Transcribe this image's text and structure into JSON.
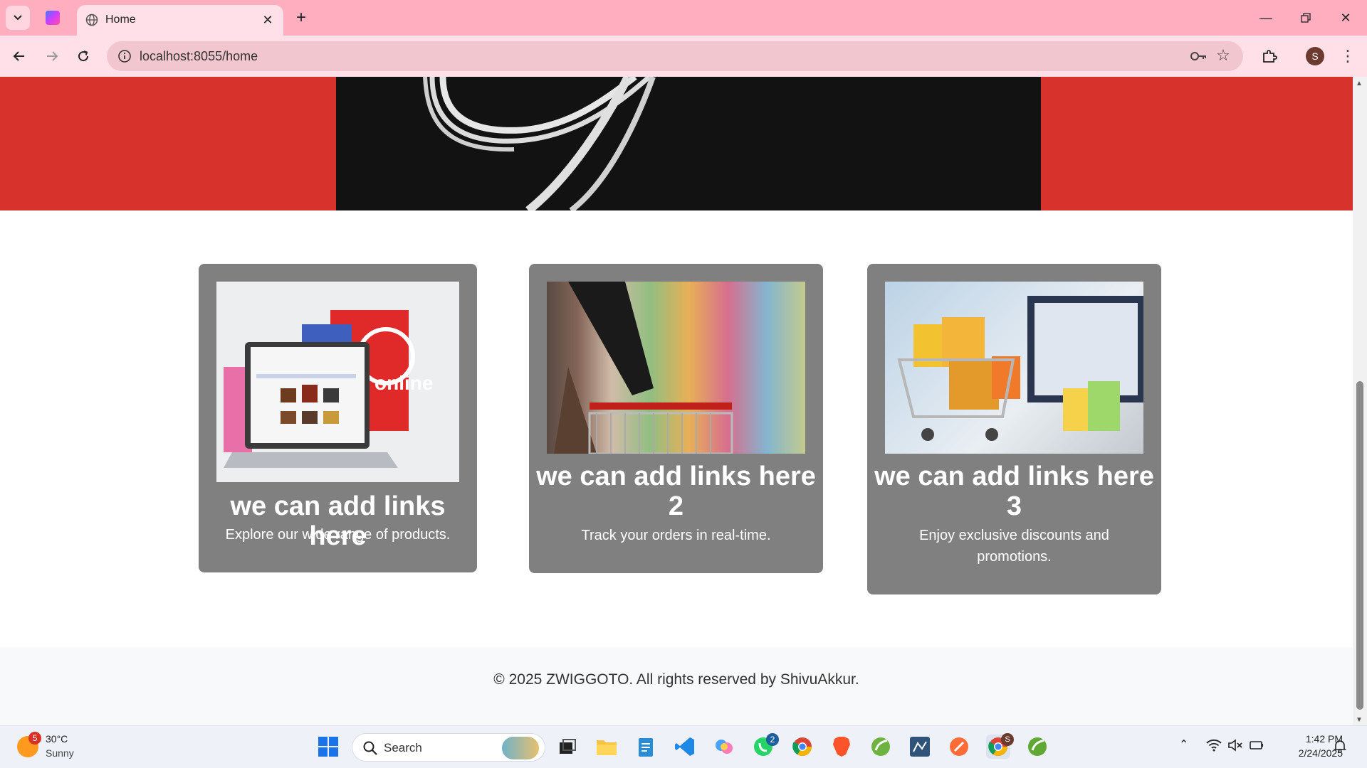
{
  "browser": {
    "tab_title": "Home",
    "url": "localhost:8055/home",
    "profile_initial": "S"
  },
  "cards": [
    {
      "title": "we can add links here",
      "text": "Explore our wide range of products.",
      "image": "laptop-shopping-bags-image"
    },
    {
      "title": "we can add links here 2",
      "text": "Track your orders in real-time.",
      "image": "supermarket-cart-image"
    },
    {
      "title": "we can add links here 3",
      "text": "Enjoy exclusive discounts and promotions.",
      "image": "cart-laptop-bags-image"
    }
  ],
  "footer": {
    "text": "© 2025 ZWIGGOTO. All rights reserved by ShivuAkkur."
  },
  "taskbar": {
    "weather_temp": "30°C",
    "weather_condition": "Sunny",
    "weather_badge": "5",
    "search_label": "Search",
    "whatsapp_badge": "2",
    "chrome_profile_badge": "S",
    "time": "1:42 PM",
    "date": "2/24/2025"
  },
  "colors": {
    "tab_bar": "#ffaec0",
    "toolbar": "#ffe0e8",
    "hero_red": "#d7322c",
    "card_gray": "#808080",
    "footer_bg": "#f8f9fa"
  }
}
